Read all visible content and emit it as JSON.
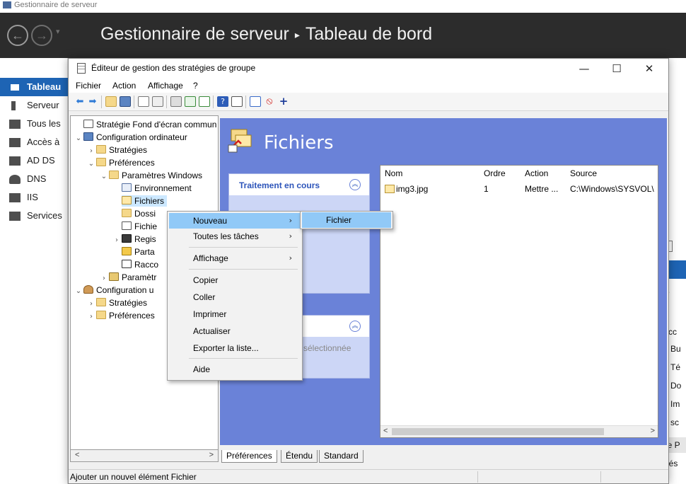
{
  "server_manager": {
    "title_text": "Gestionnaire de serveur",
    "header_app": "Gestionnaire de serveur",
    "header_sep": "▸",
    "header_page": "Tableau de bord",
    "nav": [
      "Tableau",
      "Serveur",
      "Tous les",
      "Accès à",
      "AD DS",
      "DNS",
      "IIS",
      "Services"
    ],
    "right_fragments": [
      "er",
      "Acc",
      "Bu",
      "Té",
      "Do",
      "Im",
      "sc",
      "Ce P",
      "Rés"
    ]
  },
  "gpo_editor": {
    "title": "Éditeur de gestion des stratégies de groupe",
    "window_buttons": {
      "minimize": "—",
      "maximize": "☐",
      "close": "✕"
    },
    "menu": [
      "Fichier",
      "Action",
      "Affichage",
      "?"
    ],
    "tree": [
      {
        "label": "Stratégie Fond d'écran commun",
        "level": 0,
        "expander": "",
        "icon": "doc"
      },
      {
        "label": "Configuration ordinateur",
        "level": 0,
        "expander": "v",
        "icon": "comp"
      },
      {
        "label": "Stratégies",
        "level": 1,
        "expander": ">",
        "icon": "folder"
      },
      {
        "label": "Préférences",
        "level": 1,
        "expander": "v",
        "icon": "folder"
      },
      {
        "label": "Paramètres Windows",
        "level": 2,
        "expander": "v",
        "icon": "folder"
      },
      {
        "label": "Environnement",
        "level": 3,
        "expander": "",
        "icon": "env"
      },
      {
        "label": "Fichiers",
        "level": 3,
        "expander": "",
        "icon": "file"
      },
      {
        "label": "Dossi",
        "level": 3,
        "expander": "",
        "icon": "folder"
      },
      {
        "label": "Fichie",
        "level": 3,
        "expander": "",
        "icon": "doc"
      },
      {
        "label": "Regis",
        "level": 3,
        "expander": ">",
        "icon": "reg"
      },
      {
        "label": "Parta",
        "level": 3,
        "expander": "",
        "icon": "share"
      },
      {
        "label": "Racco",
        "level": 3,
        "expander": "",
        "icon": "link"
      },
      {
        "label": "Paramètr",
        "level": 2,
        "expander": ">",
        "icon": "param"
      },
      {
        "label": "Configuration u",
        "level": 0,
        "expander": "v",
        "icon": "user"
      },
      {
        "label": "Stratégies",
        "level": 1,
        "expander": ">",
        "icon": "folder"
      },
      {
        "label": "Préférences",
        "level": 1,
        "expander": ">",
        "icon": "folder"
      }
    ],
    "content_title": "Fichiers",
    "panel1_label": "Traitement en cours",
    "panel2_text": "e sélectionnée",
    "columns": [
      "Nom",
      "Ordre",
      "Action",
      "Source"
    ],
    "rows": [
      {
        "name": "img3.jpg",
        "order": "1",
        "action": "Mettre ...",
        "source": "C:\\Windows\\SYSVOL\\"
      }
    ],
    "tabs": [
      "Préférences",
      "Étendu",
      "Standard"
    ],
    "status": "Ajouter un nouvel élément Fichier"
  },
  "context_menu": {
    "items": [
      {
        "label": "Nouveau",
        "submenu": true
      },
      {
        "label": "Toutes les tâches",
        "submenu": true
      },
      {
        "label": "Affichage",
        "submenu": true
      },
      {
        "label": "Copier",
        "submenu": false
      },
      {
        "label": "Coller",
        "submenu": false
      },
      {
        "label": "Imprimer",
        "submenu": false
      },
      {
        "label": "Actualiser",
        "submenu": false
      },
      {
        "label": "Exporter la liste...",
        "submenu": false
      },
      {
        "label": "Aide",
        "submenu": false
      }
    ],
    "submenu_item": "Fichier"
  },
  "colors": {
    "accent": "#1e64b4",
    "content_bg": "#6a82d8",
    "menu_highlight": "#91c9f7",
    "header_bg": "#2c2c2c"
  }
}
